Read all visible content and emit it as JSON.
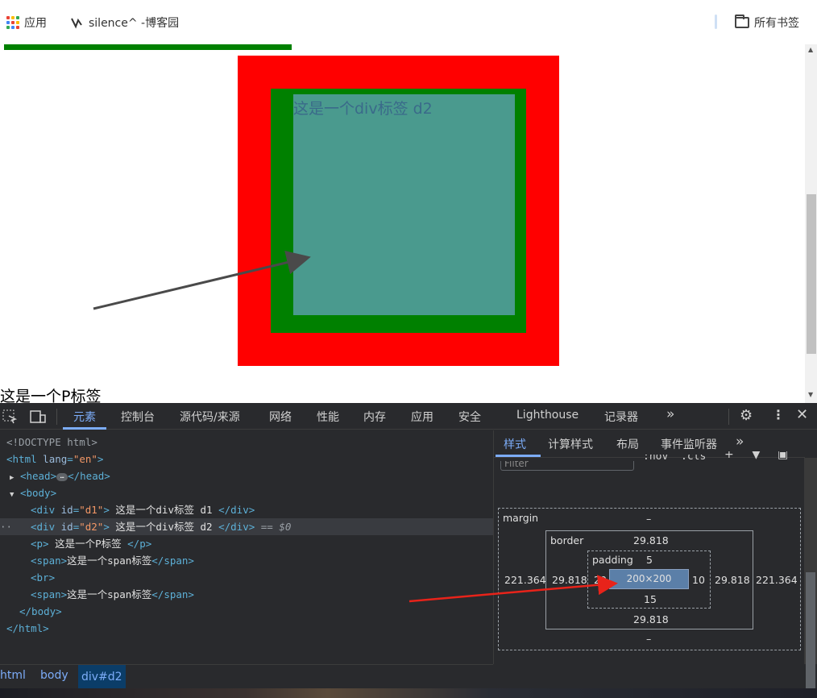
{
  "bookmarks_bar": {
    "apps_label": "应用",
    "site_label": "silence^ -博客园",
    "all_bookmarks_label": "所有书签"
  },
  "page": {
    "d2_text": "这是一个div标签 d2",
    "p_text": "这是一个P标签"
  },
  "devtools": {
    "tabs": [
      "元素",
      "控制台",
      "源代码/来源",
      "网络",
      "性能",
      "内存",
      "应用",
      "安全",
      "Lighthouse",
      "记录器",
      "»"
    ],
    "dom_lines": [
      {
        "indent": 0,
        "text": "<!DOCTYPE html>"
      },
      {
        "indent": 0,
        "text": "<html lang=\"en\">"
      },
      {
        "indent": 1,
        "text": "<head>…</head>"
      },
      {
        "indent": 1,
        "text": "<body>"
      },
      {
        "indent": 2,
        "text": "<div id=\"d1\"> 这是一个div标签 d1 </div>"
      },
      {
        "indent": 2,
        "text": "<div id=\"d2\"> 这是一个div标签 d2 </div> == $0"
      },
      {
        "indent": 2,
        "text": "<p> 这是一个P标签 </p>"
      },
      {
        "indent": 2,
        "text": "<span>这是一个span标签</span>"
      },
      {
        "indent": 2,
        "text": "<br>"
      },
      {
        "indent": 2,
        "text": "<span>这是一个span标签</span>"
      },
      {
        "indent": 1,
        "text": "</body>"
      },
      {
        "indent": 0,
        "text": "</html>"
      }
    ],
    "breadcrumbs": [
      "html",
      "body",
      "div#d2"
    ],
    "styles_tabs": [
      "样式",
      "计算样式",
      "布局",
      "事件监听器",
      "»"
    ],
    "filter_placeholder": "Filter",
    "hov_label": ":hov",
    "cls_label": ".cls",
    "box_model": {
      "margin_label": "margin",
      "margin_top": "–",
      "margin_bottom": "–",
      "margin_left": "221.364",
      "margin_right": "221.364",
      "border_label": "border",
      "border_top": "29.818",
      "border_bottom": "29.818",
      "border_left": "29.818",
      "border_right": "29.818",
      "padding_label": "padding",
      "padding_top": "5",
      "padding_bottom": "15",
      "padding_left": "20",
      "padding_right": "10",
      "content": "200×200"
    }
  },
  "colors": {
    "d1_background": "#ff0000",
    "d2_border": "#008000",
    "d2_content": "#4a9a8e",
    "devtools_accent": "#7cacf8"
  }
}
